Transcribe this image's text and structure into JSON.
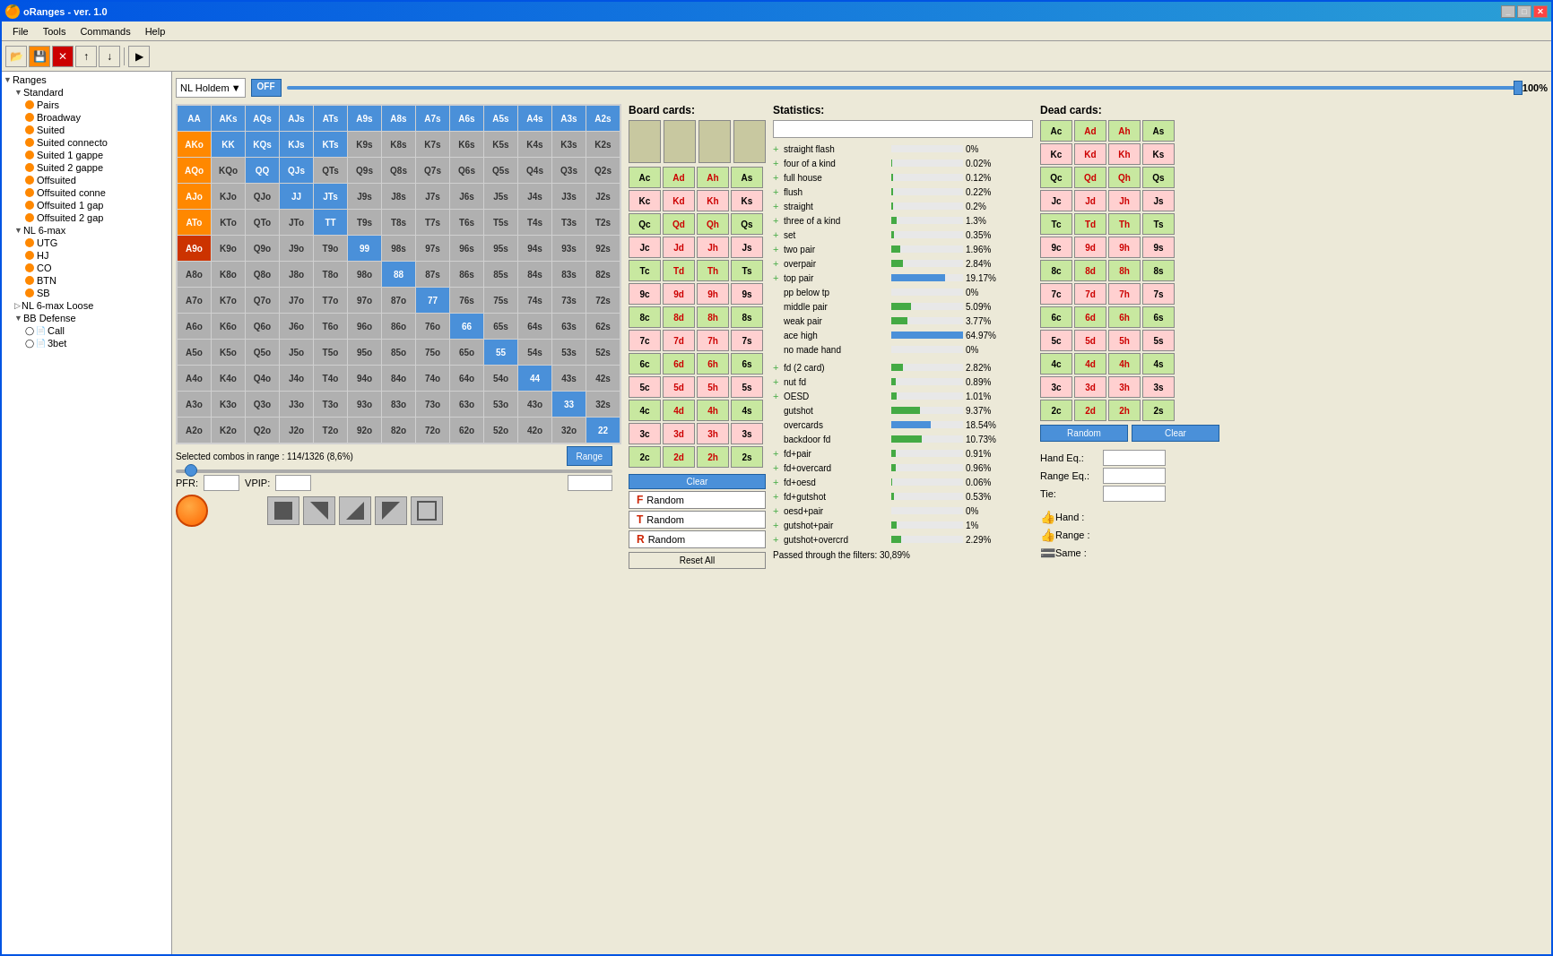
{
  "window": {
    "title": "oRanges - ver. 1.0",
    "titlebar_icon": "🍊"
  },
  "menubar": {
    "items": [
      "File",
      "Tools",
      "Commands",
      "Help"
    ]
  },
  "top_controls": {
    "holdem_label": "NL Holdem",
    "off_label": "OFF",
    "pct_label": "100%"
  },
  "sidebar": {
    "root_label": "Ranges",
    "groups": [
      {
        "label": "Standard",
        "expanded": true
      },
      {
        "label": "Pairs"
      },
      {
        "label": "Broadway"
      },
      {
        "label": "Suited"
      },
      {
        "label": "Suited connecto"
      },
      {
        "label": "Suited 1 gappe"
      },
      {
        "label": "Suited 2 gappe"
      },
      {
        "label": "Offsuited"
      },
      {
        "label": "Offsuited conne"
      },
      {
        "label": "Offsuited 1 gap"
      },
      {
        "label": "Offsuited 2 gap"
      },
      {
        "label": "NL 6-max",
        "expanded": true
      },
      {
        "label": "UTG"
      },
      {
        "label": "HJ"
      },
      {
        "label": "CO"
      },
      {
        "label": "BTN"
      },
      {
        "label": "SB"
      },
      {
        "label": "NL 6-max Loose"
      },
      {
        "label": "BB Defense",
        "expanded": true
      },
      {
        "label": "Call"
      },
      {
        "label": "3bet"
      }
    ]
  },
  "grid": {
    "headers": [
      "AA",
      "AKs",
      "AQs",
      "AJs",
      "ATs",
      "A9s",
      "A8s",
      "A7s",
      "A6s",
      "A5s",
      "A4s",
      "A3s",
      "A2s"
    ],
    "rows": [
      [
        "AA",
        "AKs",
        "AQs",
        "AJs",
        "ATs",
        "A9s",
        "A8s",
        "A7s",
        "A6s",
        "A5s",
        "A4s",
        "A3s",
        "A2s"
      ],
      [
        "AKo",
        "KK",
        "KQs",
        "KJs",
        "KTs",
        "K9s",
        "K8s",
        "K7s",
        "K6s",
        "K5s",
        "K4s",
        "K3s",
        "K2s"
      ],
      [
        "AQo",
        "KQo",
        "QQ",
        "QJs",
        "QTs",
        "Q9s",
        "Q8s",
        "Q7s",
        "Q6s",
        "Q5s",
        "Q4s",
        "Q3s",
        "Q2s"
      ],
      [
        "AJo",
        "KJo",
        "QJo",
        "JJ",
        "JTs",
        "J9s",
        "J8s",
        "J7s",
        "J6s",
        "J5s",
        "J4s",
        "J3s",
        "J2s"
      ],
      [
        "ATo",
        "KTo",
        "QTo",
        "JTo",
        "TT",
        "T9s",
        "T8s",
        "T7s",
        "T6s",
        "T5s",
        "T4s",
        "T3s",
        "T2s"
      ],
      [
        "A9o",
        "K9o",
        "Q9o",
        "J9o",
        "T9o",
        "99",
        "98s",
        "97s",
        "96s",
        "95s",
        "94s",
        "93s",
        "92s"
      ],
      [
        "A8o",
        "K8o",
        "Q8o",
        "J8o",
        "T8o",
        "98o",
        "88",
        "87s",
        "86s",
        "85s",
        "84s",
        "83s",
        "82s"
      ],
      [
        "A7o",
        "K7o",
        "Q7o",
        "J7o",
        "T7o",
        "97o",
        "87o",
        "77",
        "76s",
        "75s",
        "74s",
        "73s",
        "72s"
      ],
      [
        "A6o",
        "K6o",
        "Q6o",
        "J6o",
        "T6o",
        "96o",
        "86o",
        "76o",
        "66",
        "65s",
        "64s",
        "63s",
        "62s"
      ],
      [
        "A5o",
        "K5o",
        "Q5o",
        "J5o",
        "T5o",
        "95o",
        "85o",
        "75o",
        "65o",
        "55",
        "54s",
        "53s",
        "52s"
      ],
      [
        "A4o",
        "K4o",
        "Q4o",
        "J4o",
        "T4o",
        "94o",
        "84o",
        "74o",
        "64o",
        "54o",
        "44",
        "43s",
        "42s"
      ],
      [
        "A3o",
        "K3o",
        "Q3o",
        "J3o",
        "T3o",
        "93o",
        "83o",
        "73o",
        "63o",
        "53o",
        "43o",
        "33",
        "32s"
      ],
      [
        "A2o",
        "K2o",
        "Q2o",
        "J2o",
        "T2o",
        "92o",
        "82o",
        "72o",
        "62o",
        "52o",
        "42o",
        "32o",
        "22"
      ]
    ],
    "cell_colors": {
      "AA": "blue",
      "AKs": "blue",
      "AQs": "blue",
      "AJs": "blue",
      "ATs": "blue",
      "A9s": "orange-highlight",
      "KK": "blue",
      "KQs": "blue",
      "KJs": "blue",
      "KTs": "blue",
      "QQ": "blue",
      "QJs": "blue",
      "JJ": "blue",
      "JTs": "blue",
      "TT": "blue",
      "99": "blue",
      "88": "blue",
      "77": "blue",
      "66": "blue",
      "55": "blue",
      "44": "blue",
      "33": "blue",
      "22": "blue",
      "AKo": "orange",
      "AQo": "orange",
      "AJo": "orange",
      "ATo": "orange",
      "A9o": "cursor"
    }
  },
  "combos_label": "Selected combos in range : 114/1326 (8,6%)",
  "range_btn": "Range",
  "pfr_label": "PFR:",
  "vpip_label": "VPIP:",
  "board_panel": {
    "title": "Board cards:",
    "slots": [
      "",
      "",
      "",
      "",
      ""
    ],
    "card_grid": [
      [
        "Ac",
        "Ad",
        "Ah",
        "As"
      ],
      [
        "Kc",
        "Kd",
        "Kh",
        "Ks"
      ],
      [
        "Qc",
        "Qd",
        "Qh",
        "Qs"
      ],
      [
        "Jc",
        "Jd",
        "Jh",
        "Js"
      ],
      [
        "Tc",
        "Td",
        "Th",
        "Ts"
      ],
      [
        "9c",
        "9d",
        "9h",
        "9s"
      ],
      [
        "8c",
        "8d",
        "8h",
        "8s"
      ],
      [
        "7c",
        "7d",
        "7h",
        "7s"
      ],
      [
        "6c",
        "6d",
        "6h",
        "6s"
      ],
      [
        "5c",
        "5d",
        "5h",
        "5s"
      ],
      [
        "4c",
        "4d",
        "4h",
        "4s"
      ],
      [
        "3c",
        "3d",
        "3h",
        "3s"
      ],
      [
        "2c",
        "2d",
        "2h",
        "2s"
      ]
    ],
    "clear_btn": "Clear",
    "random_btns": [
      "F  Random",
      "T  Random",
      "R  Random"
    ],
    "reset_all_btn": "Reset All"
  },
  "stats_panel": {
    "title": "Statistics:",
    "stats": [
      {
        "label": "straight flash",
        "pct": "0%",
        "bar": 0,
        "has_plus": true
      },
      {
        "label": "four of a kind",
        "pct": "0.02%",
        "bar": 1,
        "has_plus": true
      },
      {
        "label": "full house",
        "pct": "0.12%",
        "bar": 2,
        "has_plus": true
      },
      {
        "label": "flush",
        "pct": "0.22%",
        "bar": 3,
        "has_plus": true
      },
      {
        "label": "straight",
        "pct": "0.2%",
        "bar": 3,
        "has_plus": true
      },
      {
        "label": "three of a kind",
        "pct": "1.3%",
        "bar": 8,
        "has_plus": true
      },
      {
        "label": "set",
        "pct": "0.35%",
        "bar": 4,
        "has_plus": true
      },
      {
        "label": "two pair",
        "pct": "1.96%",
        "bar": 12,
        "has_plus": true
      },
      {
        "label": "overpair",
        "pct": "2.84%",
        "bar": 16,
        "has_plus": true
      },
      {
        "label": "top pair",
        "pct": "19.17%",
        "bar": 75,
        "has_plus": true
      },
      {
        "label": "pp below tp",
        "pct": "0%",
        "bar": 0,
        "has_plus": false
      },
      {
        "label": "middle pair",
        "pct": "5.09%",
        "bar": 28,
        "has_plus": false
      },
      {
        "label": "weak pair",
        "pct": "3.77%",
        "bar": 22,
        "has_plus": false
      },
      {
        "label": "ace high",
        "pct": "64.97%",
        "bar": 100,
        "has_plus": false
      },
      {
        "label": "no made hand",
        "pct": "0%",
        "bar": 0,
        "has_plus": false
      },
      {
        "label": "fd (2 card)",
        "pct": "2.82%",
        "bar": 16,
        "has_plus": true
      },
      {
        "label": "nut fd",
        "pct": "0.89%",
        "bar": 6,
        "has_plus": true
      },
      {
        "label": "OESD",
        "pct": "1.01%",
        "bar": 7,
        "has_plus": true
      },
      {
        "label": "gutshot",
        "pct": "9.37%",
        "bar": 40,
        "has_plus": false
      },
      {
        "label": "overcards",
        "pct": "18.54%",
        "bar": 55,
        "has_plus": false
      },
      {
        "label": "backdoor fd",
        "pct": "10.73%",
        "bar": 42,
        "has_plus": false
      },
      {
        "label": "fd+pair",
        "pct": "0.91%",
        "bar": 6,
        "has_plus": true
      },
      {
        "label": "fd+overcard",
        "pct": "0.96%",
        "bar": 6,
        "has_plus": true
      },
      {
        "label": "fd+oesd",
        "pct": "0.06%",
        "bar": 1,
        "has_plus": true
      },
      {
        "label": "fd+gutshot",
        "pct": "0.53%",
        "bar": 4,
        "has_plus": true
      },
      {
        "label": "oesd+pair",
        "pct": "0%",
        "bar": 0,
        "has_plus": true
      },
      {
        "label": "gutshot+pair",
        "pct": "1%",
        "bar": 7,
        "has_plus": true
      },
      {
        "label": "gutshot+overcrd",
        "pct": "2.29%",
        "bar": 14,
        "has_plus": true
      }
    ],
    "passed_label": "Passed through the filters: 30,89%"
  },
  "dead_panel": {
    "title": "Dead cards:",
    "card_grid": [
      [
        "Ac",
        "Ad",
        "Ah",
        "As"
      ],
      [
        "Kc",
        "Kd",
        "Kh",
        "Ks"
      ],
      [
        "Qc",
        "Qd",
        "Qh",
        "Qs"
      ],
      [
        "Jc",
        "Jd",
        "Jh",
        "Js"
      ],
      [
        "Tc",
        "Td",
        "Th",
        "Ts"
      ],
      [
        "9c",
        "9d",
        "9h",
        "9s"
      ],
      [
        "8c",
        "8d",
        "8h",
        "8s"
      ],
      [
        "7c",
        "7d",
        "7h",
        "7s"
      ],
      [
        "6c",
        "6d",
        "6h",
        "6s"
      ],
      [
        "5c",
        "5d",
        "5h",
        "5s"
      ],
      [
        "4c",
        "4d",
        "4h",
        "4s"
      ],
      [
        "3c",
        "3d",
        "3h",
        "3s"
      ],
      [
        "2c",
        "2d",
        "2h",
        "2s"
      ]
    ],
    "random_btn": "Random",
    "clear_btn": "Clear",
    "eq_rows": [
      {
        "label": "Hand Eq.:",
        "value": ""
      },
      {
        "label": "Range Eq.:",
        "value": ""
      },
      {
        "label": "Tie:",
        "value": ""
      }
    ],
    "hand_label": "Hand :",
    "range_label": "Range :",
    "same_label": "Same :"
  }
}
